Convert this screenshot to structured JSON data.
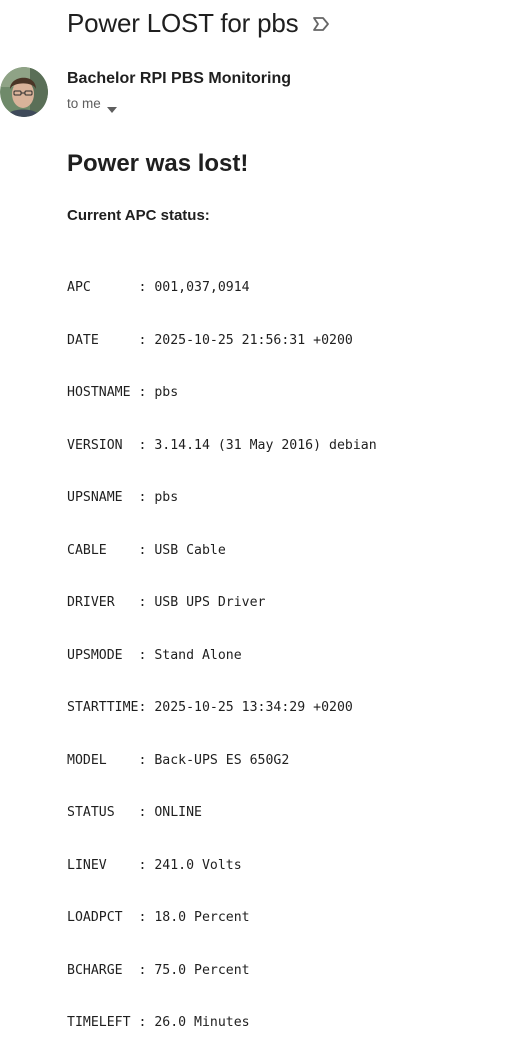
{
  "email": {
    "subject": "Power LOST for pbs",
    "sender": "Bachelor RPI PBS Monitoring",
    "recipient": "to me",
    "icons": {
      "label": "label-outline-icon",
      "caret": "chevron-down-icon",
      "avatar": "sender-avatar"
    }
  },
  "body": {
    "heading": "Power was lost!",
    "subheading": "Current APC status:",
    "status_lines": [
      "APC      : 001,037,0914",
      "DATE     : 2025-10-25 21:56:31 +0200",
      "HOSTNAME : pbs",
      "VERSION  : 3.14.14 (31 May 2016) debian",
      "UPSNAME  : pbs",
      "CABLE    : USB Cable",
      "DRIVER   : USB UPS Driver",
      "UPSMODE  : Stand Alone",
      "STARTTIME: 2025-10-25 13:34:29 +0200",
      "MODEL    : Back-UPS ES 650G2",
      "STATUS   : ONLINE",
      "LINEV    : 241.0 Volts",
      "LOADPCT  : 18.0 Percent",
      "BCHARGE  : 75.0 Percent",
      "TIMELEFT : 26.0 Minutes"
    ]
  }
}
